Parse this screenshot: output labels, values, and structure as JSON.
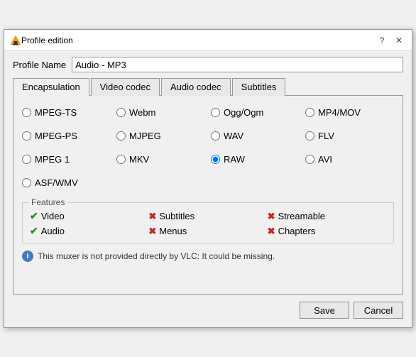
{
  "titleBar": {
    "title": "Profile edition",
    "helpLabel": "?",
    "closeLabel": "✕"
  },
  "profileName": {
    "label": "Profile Name",
    "value": "Audio - MP3"
  },
  "tabs": [
    {
      "id": "encapsulation",
      "label": "Encapsulation",
      "active": true
    },
    {
      "id": "video-codec",
      "label": "Video codec",
      "active": false
    },
    {
      "id": "audio-codec",
      "label": "Audio codec",
      "active": false
    },
    {
      "id": "subtitles",
      "label": "Subtitles",
      "active": false
    }
  ],
  "radioOptions": [
    {
      "id": "mpeg-ts",
      "label": "MPEG-TS",
      "checked": false
    },
    {
      "id": "webm",
      "label": "Webm",
      "checked": false
    },
    {
      "id": "ogg-ogm",
      "label": "Ogg/Ogm",
      "checked": false
    },
    {
      "id": "mp4-mov",
      "label": "MP4/MOV",
      "checked": false
    },
    {
      "id": "mpeg-ps",
      "label": "MPEG-PS",
      "checked": false
    },
    {
      "id": "mjpeg",
      "label": "MJPEG",
      "checked": false
    },
    {
      "id": "wav",
      "label": "WAV",
      "checked": false
    },
    {
      "id": "flv",
      "label": "FLV",
      "checked": false
    },
    {
      "id": "mpeg1",
      "label": "MPEG 1",
      "checked": false
    },
    {
      "id": "mkv",
      "label": "MKV",
      "checked": false
    },
    {
      "id": "raw",
      "label": "RAW",
      "checked": true
    },
    {
      "id": "avi",
      "label": "AVI",
      "checked": false
    },
    {
      "id": "asf-wmv",
      "label": "ASF/WMV",
      "checked": false
    }
  ],
  "features": {
    "sectionTitle": "Features",
    "items": [
      {
        "label": "Video",
        "supported": true
      },
      {
        "label": "Subtitles",
        "supported": false
      },
      {
        "label": "Streamable",
        "supported": false
      },
      {
        "label": "Audio",
        "supported": true
      },
      {
        "label": "Menus",
        "supported": false
      },
      {
        "label": "Chapters",
        "supported": false
      }
    ]
  },
  "infoMessage": "This muxer is not provided directly by VLC: It could be missing.",
  "buttons": {
    "save": "Save",
    "cancel": "Cancel"
  }
}
